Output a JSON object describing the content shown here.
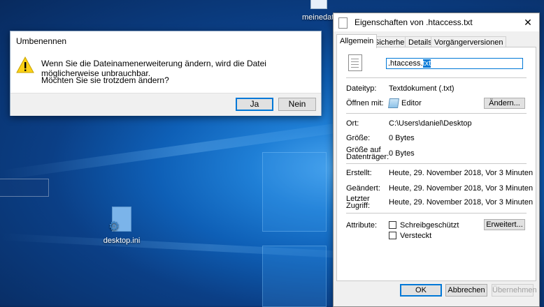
{
  "desktop": {
    "top_icon_label": "meinedat",
    "ini_icon_label": "desktop.ini"
  },
  "rename_dialog": {
    "title": "Umbenennen",
    "message_line1": "Wenn Sie die Dateinamenerweiterung ändern, wird die Datei möglicherweise unbrauchbar.",
    "message_line2": "Möchten Sie sie trotzdem ändern?",
    "yes_label": "Ja",
    "no_label": "Nein"
  },
  "properties": {
    "title": "Eigenschaften von .htaccess.txt",
    "tabs": [
      "Allgemein",
      "Sicherheit",
      "Details",
      "Vorgängerversionen"
    ],
    "filename_prefix": ".htaccess",
    "filename_selected": "txt",
    "filename_dot": ".",
    "file_type_label": "Dateityp:",
    "file_type_value": "Textdokument (.txt)",
    "open_with_label": "Öffnen mit:",
    "open_with_value": "Editor",
    "change_button": "Ändern...",
    "location_label": "Ort:",
    "location_value": "C:\\Users\\daniel\\Desktop",
    "size_label": "Größe:",
    "size_value": "0 Bytes",
    "size_on_disk_label_1": "Größe auf",
    "size_on_disk_label_2": "Datenträger:",
    "size_on_disk_value": "0 Bytes",
    "created_label": "Erstellt:",
    "created_value": "Heute, 29. November 2018, Vor 3 Minuten",
    "modified_label": "Geändert:",
    "modified_value": "Heute, 29. November 2018, Vor 3 Minuten",
    "accessed_label_1": "Letzter",
    "accessed_label_2": "Zugriff:",
    "accessed_value": "Heute, 29. November 2018, Vor 3 Minuten",
    "attributes_label": "Attribute:",
    "readonly_label": "Schreibgeschützt",
    "hidden_label": "Versteckt",
    "advanced_button": "Erweitert...",
    "ok_button": "OK",
    "cancel_button": "Abbrechen",
    "apply_button": "Übernehmen"
  }
}
